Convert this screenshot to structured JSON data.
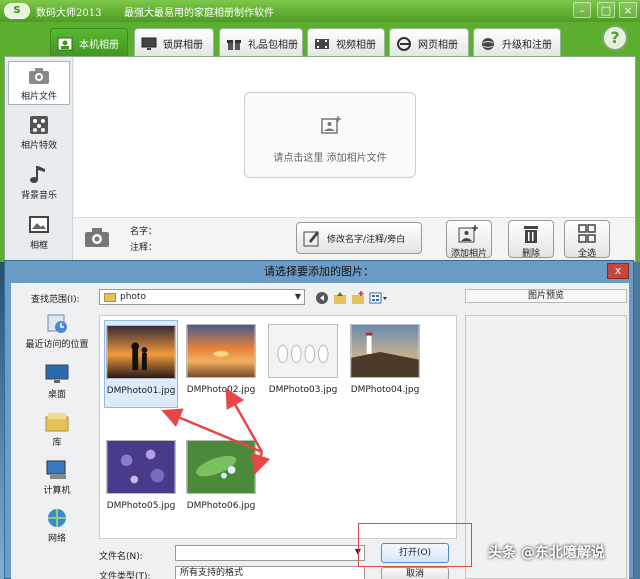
{
  "app": {
    "name": "数码大师2013",
    "slogan": "最强大最易用的家庭相册制作软件",
    "logo": "S"
  },
  "tabs": [
    {
      "label": "本机相册",
      "icon": "photo-album-icon",
      "active": true
    },
    {
      "label": "锁屏相册",
      "icon": "monitor-icon",
      "active": false
    },
    {
      "label": "礼品包相册",
      "icon": "gift-icon",
      "active": false
    },
    {
      "label": "视频相册",
      "icon": "film-icon",
      "active": false
    },
    {
      "label": "网页相册",
      "icon": "ie-icon",
      "active": false
    },
    {
      "label": "升级和注册",
      "icon": "globe-icon",
      "active": false
    }
  ],
  "help_label": "?",
  "sidebar": {
    "items": [
      {
        "label": "相片文件",
        "icon": "camera-icon",
        "active": true
      },
      {
        "label": "相片特效",
        "icon": "effects-icon",
        "active": false
      },
      {
        "label": "背景音乐",
        "icon": "music-note-icon",
        "active": false
      },
      {
        "label": "相框",
        "icon": "picture-frame-icon",
        "active": false
      }
    ]
  },
  "main": {
    "add_hint": "请点击这里 添加相片文件",
    "name_label": "名字：",
    "note_label": "注释：",
    "edit_button": "修改名字/注释/旁白",
    "add_button": "添加相片",
    "delete_button": "删除",
    "select_all_button": "全选"
  },
  "dialog": {
    "title": "请选择要添加的图片：",
    "close": "x",
    "look_in_label": "查找范围(I):",
    "look_in_value": "photo",
    "places": [
      {
        "label": "最近访问的位置",
        "icon": "recent-places-icon"
      },
      {
        "label": "桌面",
        "icon": "desktop-icon"
      },
      {
        "label": "库",
        "icon": "library-icon"
      },
      {
        "label": "计算机",
        "icon": "computer-icon"
      },
      {
        "label": "网络",
        "icon": "network-icon"
      }
    ],
    "files": [
      {
        "name": "DMPhoto01.jpg",
        "selected": true
      },
      {
        "name": "DMPhoto02.jpg",
        "selected": false
      },
      {
        "name": "DMPhoto03.jpg",
        "selected": false
      },
      {
        "name": "DMPhoto04.jpg",
        "selected": false
      },
      {
        "name": "DMPhoto05.jpg",
        "selected": false
      },
      {
        "name": "DMPhoto06.jpg",
        "selected": false
      }
    ],
    "preview_label": "图片预览",
    "filename_label": "文件名(N):",
    "filename_value": "",
    "filetype_label": "文件类型(T):",
    "filetype_value": "所有支持的格式",
    "open_button": "打开(O)",
    "cancel_button": "取消"
  },
  "watermark": "头条 @东北噫解说",
  "colors": {
    "brand_green": "#5cae2e",
    "dialog_blue": "#6a9cc6",
    "annotation_red": "#e64646"
  }
}
